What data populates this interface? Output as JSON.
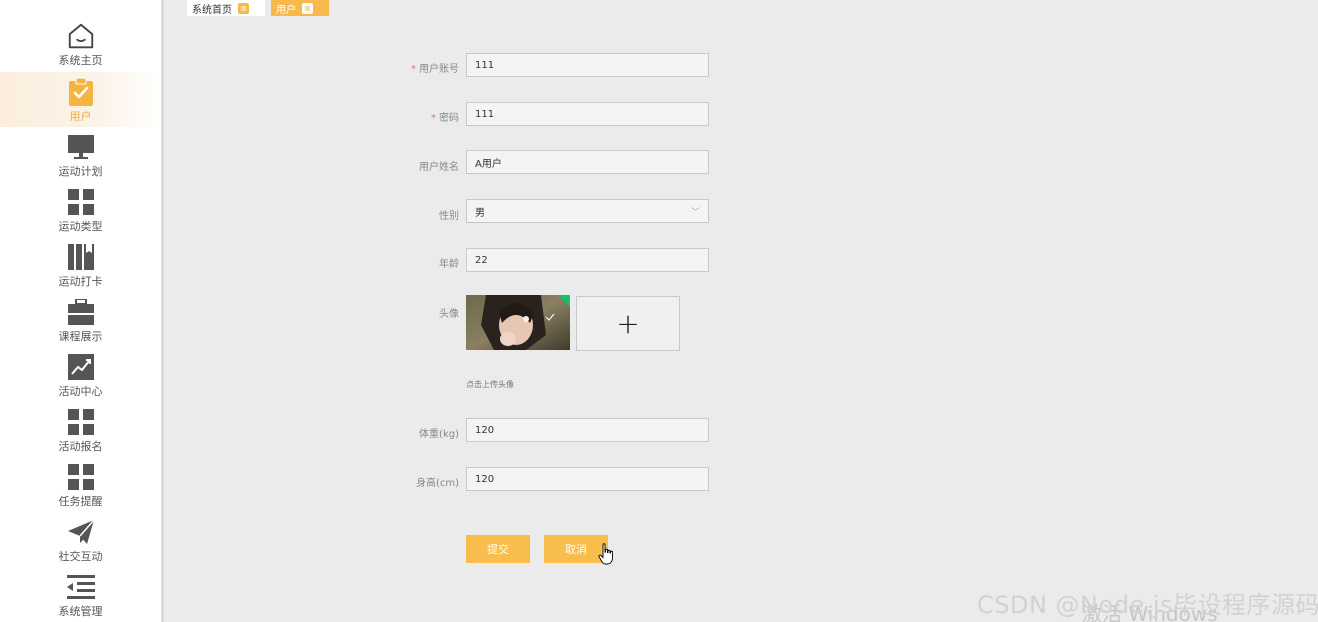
{
  "tabs": [
    {
      "label": "系统首页"
    },
    {
      "label": "用户"
    }
  ],
  "sidebar": {
    "items": [
      {
        "label": "系统主页",
        "icon": "home-icon"
      },
      {
        "label": "用户",
        "icon": "clipboard-check-icon",
        "active": true
      },
      {
        "label": "运动计划",
        "icon": "monitor-icon"
      },
      {
        "label": "运动类型",
        "icon": "grid-icon"
      },
      {
        "label": "运动打卡",
        "icon": "book-icon"
      },
      {
        "label": "课程展示",
        "icon": "briefcase-icon"
      },
      {
        "label": "活动中心",
        "icon": "chart-icon"
      },
      {
        "label": "活动报名",
        "icon": "grid-icon"
      },
      {
        "label": "任务提醒",
        "icon": "grid-icon"
      },
      {
        "label": "社交互动",
        "icon": "paper-plane-icon"
      },
      {
        "label": "系统管理",
        "icon": "menu-indent-icon"
      }
    ]
  },
  "form": {
    "account": {
      "label": "用户账号",
      "value": "111",
      "required": true
    },
    "password": {
      "label": "密码",
      "value": "111",
      "required": true
    },
    "name": {
      "label": "用户姓名",
      "value": "A用户"
    },
    "gender": {
      "label": "性别",
      "value": "男"
    },
    "age": {
      "label": "年龄",
      "value": "22"
    },
    "avatar": {
      "label": "头像",
      "hint": "点击上传头像",
      "upload_symbol": "+"
    },
    "weight": {
      "label": "体重(kg)",
      "value": "120"
    },
    "height": {
      "label": "身高(cm)",
      "value": "120"
    },
    "submit_label": "提交",
    "cancel_label": "取消",
    "required_mark": "*"
  },
  "watermarks": {
    "windows": "激活 Windows",
    "csdn": "CSDN @Node.js毕设程序源码"
  },
  "colors": {
    "accent": "#f9bd4e",
    "required": "#f56c6c",
    "background": "#ebebeb"
  }
}
